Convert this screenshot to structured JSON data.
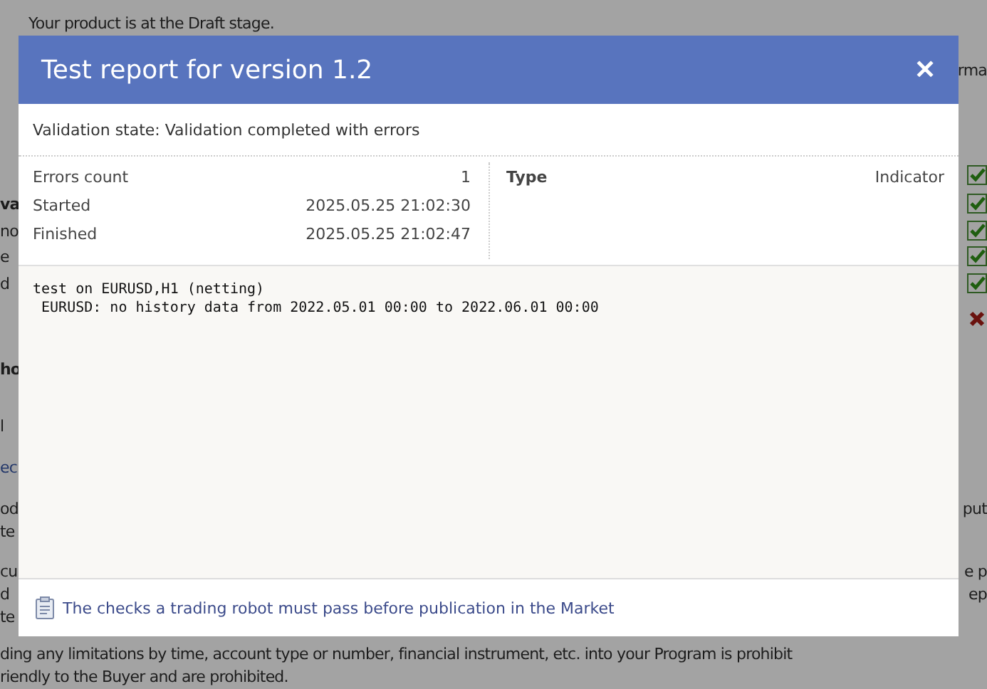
{
  "background": {
    "lines": [
      {
        "left": "Your product is at the Draft stage.",
        "indent": true
      },
      {
        "right": "rma"
      },
      {
        "kind": "check"
      },
      {
        "left": "va",
        "bold": true,
        "kind": "check"
      },
      {
        "left": "no",
        "kind": "check"
      },
      {
        "left": "e",
        "kind": "check"
      },
      {
        "left": "d",
        "kind": "check"
      },
      {
        "kind": "cross"
      },
      {
        "left": "ho",
        "bold": true
      },
      {
        "left": "l"
      },
      {
        "left": "ec",
        "link": true
      },
      {
        "left": "od",
        "right": "put"
      },
      {
        "left": "te"
      },
      {
        "left": "cu",
        "right": "e p"
      },
      {
        "left": "d",
        "right": "ep"
      },
      {
        "left": "te"
      },
      {
        "left": "ding any limitations by time, account type or number, financial instrument, etc. into your Program is prohibit"
      },
      {
        "left": "riendly to the Buyer and are prohibited."
      }
    ]
  },
  "dialog": {
    "title": "Test report for version 1.2",
    "close": "✕",
    "validation_state": "Validation state: Validation completed with errors",
    "stats": [
      {
        "label": "Errors count",
        "value": "1"
      },
      {
        "label": "Started",
        "value": "2025.05.25 21:02:30"
      },
      {
        "label": "Finished",
        "value": "2025.05.25 21:02:47"
      }
    ],
    "type": {
      "label": "Type",
      "value": "Indicator"
    },
    "log": "test on EURUSD,H1 (netting)\n EURUSD: no history data from 2022.05.01 00:00 to 2022.06.01 00:00",
    "footer_link": "The checks a trading robot must pass before publication in the Market"
  }
}
